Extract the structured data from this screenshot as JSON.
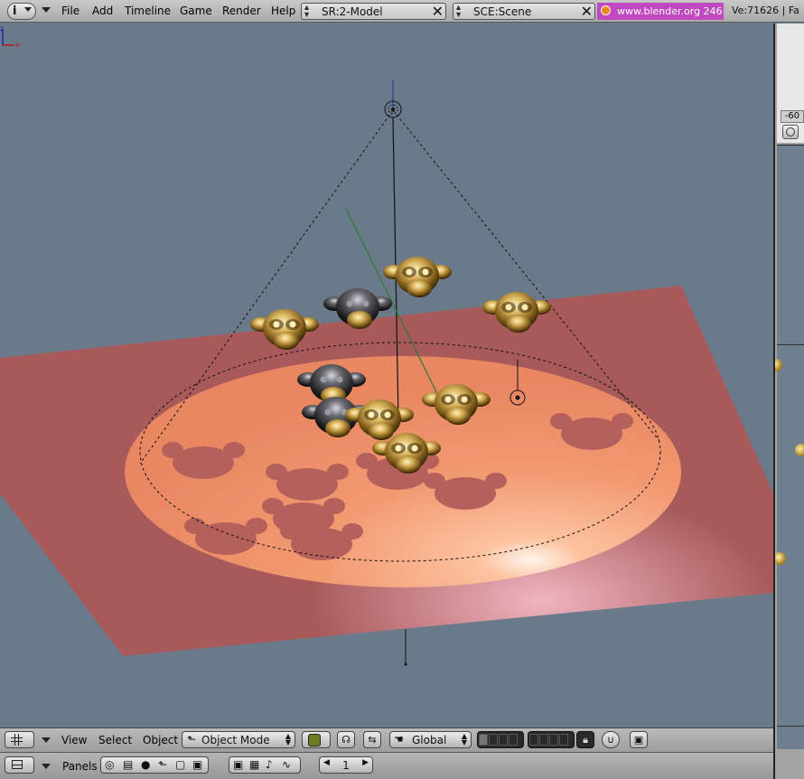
{
  "topbar": {
    "menu": [
      "File",
      "Add",
      "Timeline",
      "Game",
      "Render",
      "Help"
    ],
    "screen": "SR:2-Model",
    "scene": "SCE:Scene",
    "url": "www.blender.org 246",
    "stats": "Ve:71626 | Fa"
  },
  "side_panel": {
    "frame_value": "-60"
  },
  "view_header": {
    "menu": [
      "View",
      "Select",
      "Object"
    ],
    "mode": "Object Mode",
    "orientation": "Global"
  },
  "buttons_header": {
    "panels_label": "Panels",
    "frame": "1"
  },
  "icons": {
    "info": "info-icon",
    "scene": "scene-icon",
    "pivot": "pivot-icon",
    "hand": "hand-icon",
    "lock": "lock-icon",
    "render": "render-icon"
  },
  "colors": {
    "viewport_bg": "#6a7a8a",
    "plane": "#a55a5a",
    "spotlight": "#f2a27a",
    "monkey": "#b68d2c",
    "url_bg": "#c048c0"
  }
}
